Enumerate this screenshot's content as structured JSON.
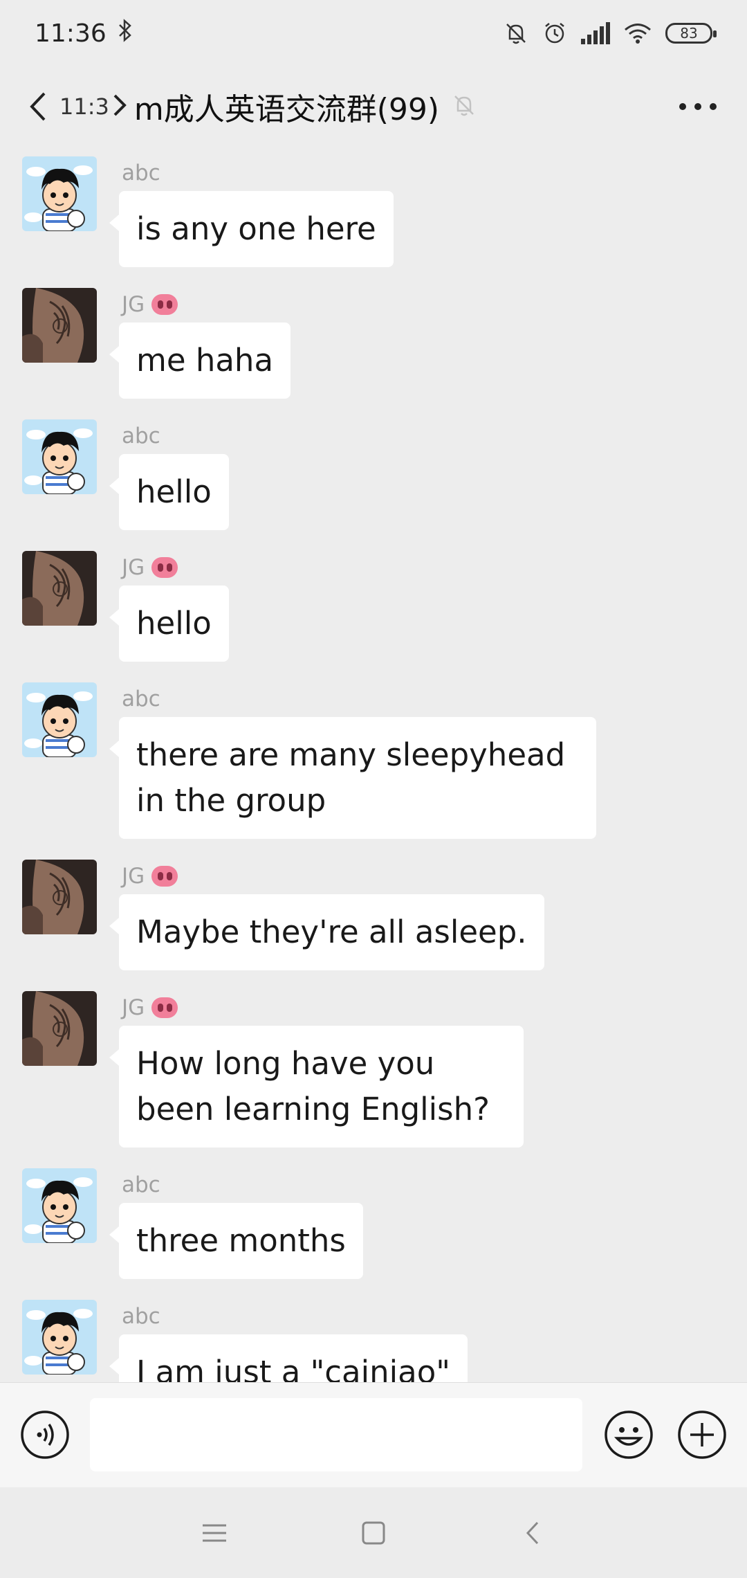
{
  "status_bar": {
    "time": "11:36",
    "battery": "83",
    "icons": [
      "bluetooth-icon",
      "mute-notification-icon",
      "alarm-icon",
      "signal-icon",
      "wifi-icon",
      "battery-icon"
    ]
  },
  "header": {
    "overlay_time": "11:3",
    "title": "m成人英语交流群(99)",
    "icons": [
      "back-arrow-icon",
      "mute-bell-icon",
      "more-dots-icon"
    ]
  },
  "messages": [
    {
      "sender": "abc",
      "text": "is any one here",
      "avatar": "cartoon-boy"
    },
    {
      "sender": "JG",
      "text": "me haha",
      "avatar": "tattoo-arm",
      "badge": "pig-emoji"
    },
    {
      "sender": "abc",
      "text": "hello",
      "avatar": "cartoon-boy"
    },
    {
      "sender": "JG",
      "text": "hello",
      "avatar": "tattoo-arm",
      "badge": "pig-emoji"
    },
    {
      "sender": "abc",
      "text": "there are many sleepyhead in the group",
      "avatar": "cartoon-boy"
    },
    {
      "sender": "JG",
      "text": "Maybe they're all asleep.",
      "avatar": "tattoo-arm",
      "badge": "pig-emoji"
    },
    {
      "sender": "JG",
      "text": "How long have you been learning English?",
      "avatar": "tattoo-arm",
      "badge": "pig-emoji"
    },
    {
      "sender": "abc",
      "text": "three months",
      "avatar": "cartoon-boy"
    },
    {
      "sender": "abc",
      "text": "I am just a \"cainiao\"",
      "avatar": "cartoon-boy"
    }
  ],
  "input_bar": {
    "value": "",
    "icons": [
      "voice-icon",
      "emoji-icon",
      "plus-icon"
    ]
  },
  "nav_bar": {
    "icons": [
      "menu-icon",
      "home-icon",
      "back-icon"
    ]
  },
  "colors": {
    "background": "#ededed",
    "bubble": "#ffffff",
    "sender_name": "#a0a0a0",
    "pig_badge": "#f17f9a"
  }
}
